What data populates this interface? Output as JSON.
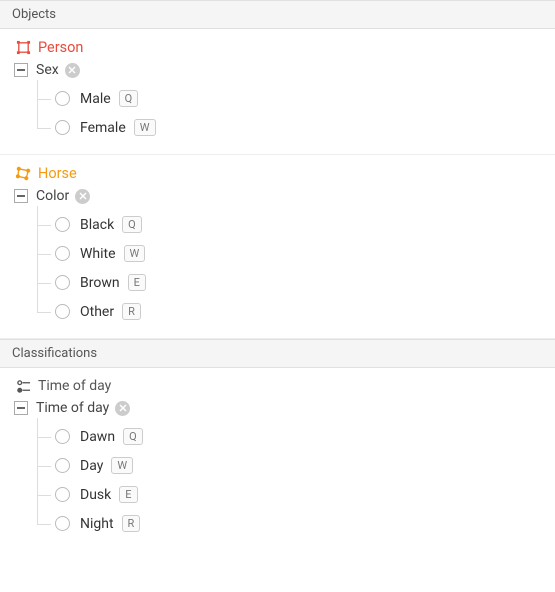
{
  "objects_header": "Objects",
  "classifications_header": "Classifications",
  "colors": {
    "person": "#e74c3c",
    "horse": "#f39c12",
    "neutral": "#555"
  },
  "objects": [
    {
      "name": "Person",
      "color": "red",
      "icon": "bbox-icon",
      "attribute": {
        "name": "Sex",
        "options": [
          {
            "label": "Male",
            "key": "Q"
          },
          {
            "label": "Female",
            "key": "W"
          }
        ]
      }
    },
    {
      "name": "Horse",
      "color": "orange",
      "icon": "polygon-icon",
      "attribute": {
        "name": "Color",
        "options": [
          {
            "label": "Black",
            "key": "Q"
          },
          {
            "label": "White",
            "key": "W"
          },
          {
            "label": "Brown",
            "key": "E"
          },
          {
            "label": "Other",
            "key": "R"
          }
        ]
      }
    }
  ],
  "classification": {
    "name": "Time of day",
    "icon": "radio-icon",
    "attribute": {
      "name": "Time of day",
      "options": [
        {
          "label": "Dawn",
          "key": "Q"
        },
        {
          "label": "Day",
          "key": "W"
        },
        {
          "label": "Dusk",
          "key": "E"
        },
        {
          "label": "Night",
          "key": "R"
        }
      ]
    }
  }
}
